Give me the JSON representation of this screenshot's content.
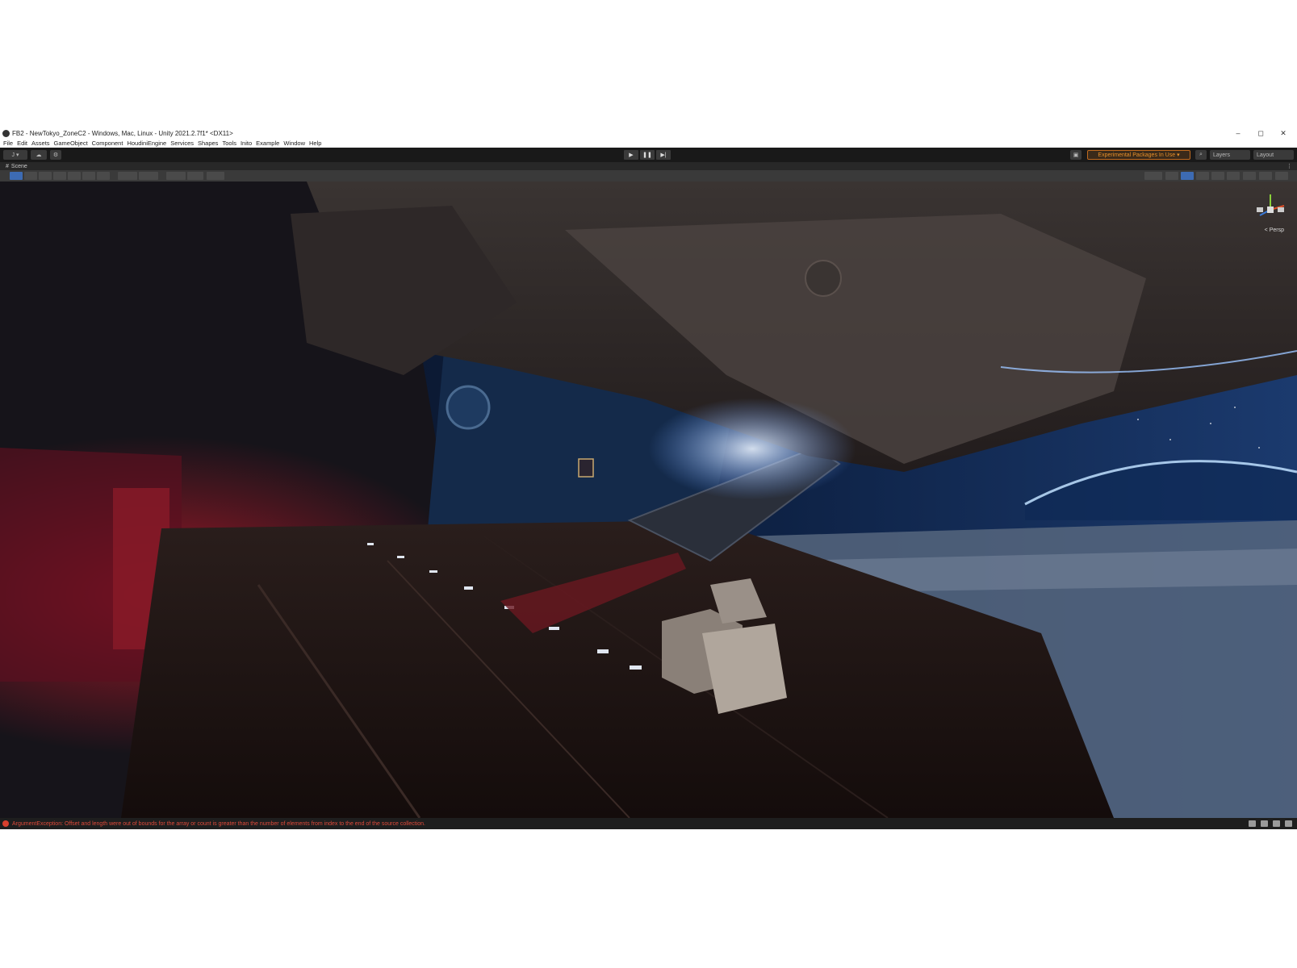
{
  "window": {
    "title": "FB2 - NewTokyo_ZoneC2 - Windows, Mac, Linux - Unity 2021.2.7f1* <DX11>",
    "controls": [
      "–",
      "◻",
      "✕"
    ]
  },
  "menu": [
    "File",
    "Edit",
    "Assets",
    "GameObject",
    "Component",
    "HoudiniEngine",
    "Services",
    "Shapes",
    "Tools",
    "Inito",
    "Example",
    "Window",
    "Help"
  ],
  "toolbar": {
    "account": "J ▾",
    "play": "▶",
    "pause": "❚❚",
    "step": "▶|",
    "experimental_badge": "Experimental Packages In Use ▾",
    "layers": "Layers",
    "layout": "Layout"
  },
  "tab": {
    "label": "Scene"
  },
  "gizmo": {
    "projection_label": "< Persp"
  },
  "status": {
    "error_message": "ArgumentException: Offset and length were out of bounds for the array or count is greater than the number of elements from index to the end of the source collection."
  },
  "colors": {
    "error": "#e04a3a",
    "accent_blue": "#3d6bb3",
    "experimental": "#e8902a"
  }
}
